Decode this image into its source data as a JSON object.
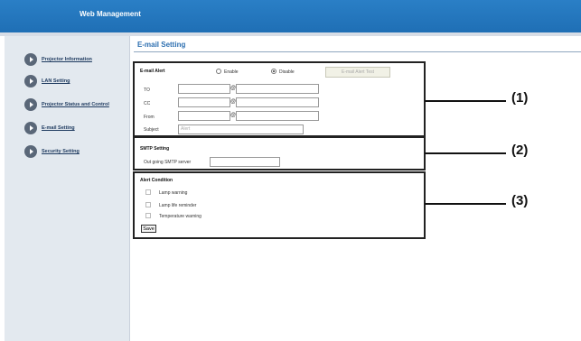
{
  "header": {
    "title": "Web Management"
  },
  "sidebar": {
    "items": [
      {
        "label": "Projector Information"
      },
      {
        "label": "LAN Setting"
      },
      {
        "label": "Projector Status and Control"
      },
      {
        "label": "E-mail Setting"
      },
      {
        "label": "Security Setting"
      }
    ]
  },
  "main": {
    "title": "E-mail Setting"
  },
  "email_alert": {
    "heading": "E-mail Alert",
    "enable_label": "Enable",
    "disable_label": "Disable",
    "selected": "Disable",
    "test_button": "E-mail Alert Test",
    "to_label": "TO",
    "cc_label": "CC",
    "from_label": "From",
    "subject_label": "Subject",
    "at_symbol": "@",
    "subject_value": "Alert"
  },
  "smtp": {
    "heading": "SMTP Setting",
    "server_label": "Out going SMTP server"
  },
  "alert_condition": {
    "heading": "Alert Condition",
    "items": [
      {
        "label": "Lamp warning"
      },
      {
        "label": "Lamp life reminder"
      },
      {
        "label": "Temperature warning"
      }
    ],
    "save_button": "Save"
  },
  "callouts": {
    "c1": "(1)",
    "c2": "(2)",
    "c3": "(3)"
  }
}
